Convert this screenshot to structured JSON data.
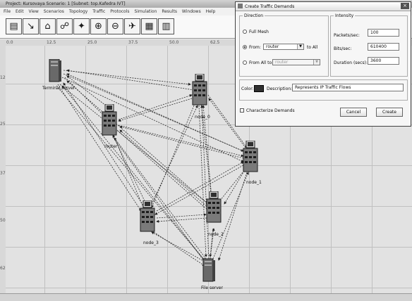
{
  "window": {
    "title": "Project: Kursovaya  Scenario: 1  [Subnet: top.Kafedra IVT]"
  },
  "menu": [
    "File",
    "Edit",
    "View",
    "Scenarios",
    "Topology",
    "Traffic",
    "Protocols",
    "Simulation",
    "Results",
    "Windows",
    "Help"
  ],
  "toolbar_icons": [
    "open-folder-icon",
    "configure-link-icon",
    "node-palette-icon",
    "check-links-icon",
    "failure-icon",
    "zoom-in-icon",
    "zoom-out-icon",
    "configure-sim-icon",
    "view-results-icon",
    "web-report-icon"
  ],
  "ruler": {
    "top": [
      "0.0",
      "12.5",
      "25.0",
      "37.5",
      "50.0",
      "62.5"
    ],
    "left": [
      "12.5",
      "25.0",
      "37.5",
      "50.0",
      "62.5"
    ]
  },
  "nodes": {
    "terminal_server": "Terminal server",
    "router": "router",
    "node_0": "node_0",
    "node_1": "node_1",
    "node_2": "node_2",
    "node_3": "node_3",
    "file_server": "File server"
  },
  "dialog": {
    "title": "Create Traffic Demands",
    "direction_legend": "Direction",
    "full_mesh": "Full Mesh",
    "from_label": "From:",
    "from_value": "router",
    "to_all": "to All",
    "from_all_to": "From All to:",
    "from_all_value": "router",
    "intensity_legend": "Intensity",
    "packets_label": "Packets/sec:",
    "packets_value": "100",
    "bits_label": "Bits/sec:",
    "bits_value": "610400",
    "duration_label": "Duration (secs):",
    "duration_value": "3600",
    "color_label": "Color:",
    "description_label": "Description:",
    "description_value": "Represents IP Traffic Flows",
    "characterize_label": "Characterize Demands",
    "cancel": "Cancel",
    "create": "Create"
  }
}
